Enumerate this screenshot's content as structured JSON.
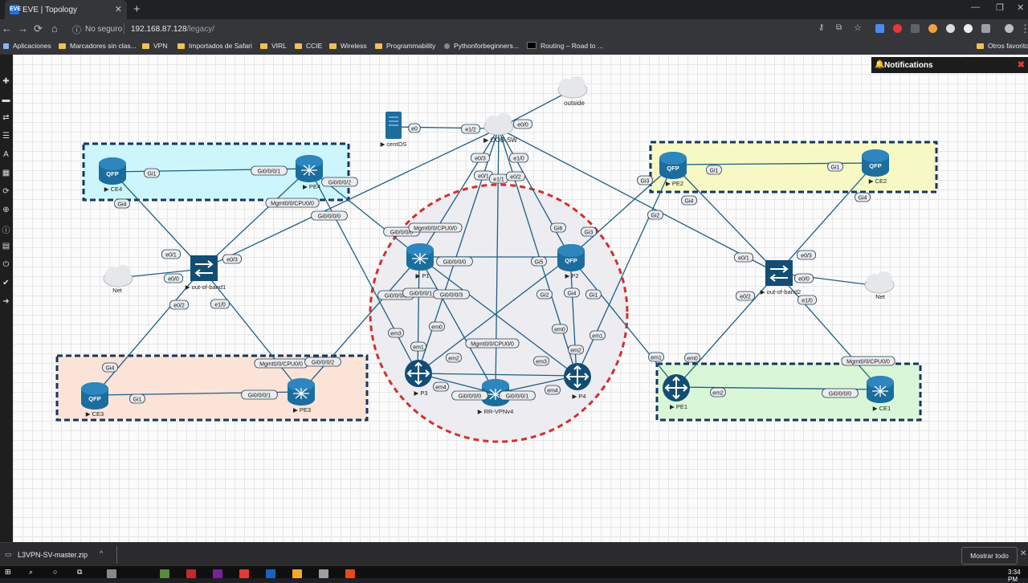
{
  "browser": {
    "tab_title": "EVE | Topology",
    "tab_favicon": "EVE",
    "new_tab": "+",
    "security_label": "No seguro",
    "url_host": "192.168.87.128",
    "url_path": "/legacy/",
    "bookmarks": [
      {
        "label": "Aplicaciones",
        "icon": "apps-icon"
      },
      {
        "label": "Marcadores sin clas...",
        "icon": "folder-icon"
      },
      {
        "label": "VPN",
        "icon": "folder-icon"
      },
      {
        "label": "Importados de Safari",
        "icon": "folder-icon"
      },
      {
        "label": "VIRL",
        "icon": "folder-icon"
      },
      {
        "label": "CCIE",
        "icon": "folder-icon"
      },
      {
        "label": "Wireless",
        "icon": "folder-icon"
      },
      {
        "label": "Programmability",
        "icon": "folder-icon"
      },
      {
        "label": "Pythonforbeginners...",
        "icon": "python-icon"
      },
      {
        "label": "Routing – Road to ...",
        "icon": "page-icon"
      },
      {
        "label": "Otros favoritos",
        "icon": "folder-icon"
      }
    ]
  },
  "notifications": {
    "title": "Notifications",
    "close": "✖"
  },
  "topology": {
    "nodes": {
      "centos": "centOS",
      "oob_sw": "OOB-SW",
      "outside": "outside",
      "ce4": "CE4",
      "pe4": "PE4",
      "ce3": "CE3",
      "pe3": "PE3",
      "oob1": "out-of-band1",
      "oob2": "out-of-band2",
      "net1": "Net",
      "net2": "Net",
      "p1": "P1",
      "p2": "P2",
      "p3": "P3",
      "p4": "P4",
      "rr": "RR-VPNv4",
      "pe2": "PE2",
      "ce2": "CE2",
      "pe1": "PE1",
      "ce1": "CE1"
    },
    "router_badge": "QFP",
    "ports": {
      "centos_e0": "e0",
      "oob_e1_2": "e1/2",
      "oob_e0_0": "e0/0",
      "oob_e0_3": "e0/3",
      "oob_e1_0": "e1/0",
      "oob_e0_1": "e0/1",
      "oob_e1_1": "e1/1",
      "oob_e0_2": "e0/2",
      "ce4_gi1": "Gi1",
      "pe4_gi0001": "Gi0/0/0/1",
      "ce4_gi4": "Gi4",
      "pe4_gi0002": "Gi0/0/0/2",
      "pe4_mgmt": "Mgmt0/0/CPU0/0",
      "pe4_gi0000": "Gi0/0/0/0",
      "o1_e01": "e0/1",
      "o1_e03": "e0/3",
      "o1_e00": "e0/0",
      "o1_e02": "e0/2",
      "o1_e10": "e1/0",
      "ce3_gi4": "Gi4",
      "ce3_gi1": "Gi1",
      "pe3_gi0001": "Gi0/0/0/1",
      "pe3_mgmt": "Mgmt0/0/CPU0/0",
      "pe3_gi0002": "Gi0/0/0/2",
      "p1_gi0000": "Gi0/0/0/0",
      "p1_mgmt": "Mgmt0/0/CPU0/0",
      "p1_gi0000b": "Gi0/0/0/0",
      "p1_gi0002": "Gi0/0/0/2",
      "p1_gi0001": "Gi0/0/0/1",
      "p1_gi0003": "Gi0/0/0/3",
      "p2_gi6": "Gi6",
      "p2_gi3": "Gi3",
      "p2_gi5": "Gi5",
      "p2_gi2": "Gi2",
      "p2_gi4": "Gi4",
      "p2_gi1": "Gi1",
      "p3_em3": "em3",
      "p3_em0": "em0",
      "p3_em1": "em1",
      "p3_em2": "em2",
      "p3_em4": "em4",
      "rr_mgmt": "Mgmt0/0/CPU0/0",
      "rr_gi0000": "Gi0/0/0/0",
      "rr_gi0001": "Gi0/0/0/1",
      "p4_em0": "em0",
      "p4_em2": "em2",
      "p4_em1": "em1",
      "p4_em3": "em3",
      "p4_em4": "em4",
      "pe2_gi3": "Gi3",
      "pe2_gi1": "Gi1",
      "pe2_gi2": "Gi2",
      "pe2_gi4": "Gi4",
      "ce2_gi1": "Gi1",
      "ce2_gi4": "Gi4",
      "o2_e03": "e0/3",
      "o2_e01": "e0/1",
      "o2_e00": "e0/0",
      "o2_e02": "e0/2",
      "o2_e10": "e1/0",
      "pe1_em1": "em1",
      "pe1_em0": "em0",
      "pe1_em2": "em2",
      "ce1_gi0000": "Gi0/0/0/0",
      "ce1_mgmt": "Mgmt0/0/CPU0/0"
    }
  },
  "downloads": {
    "file": "L3VPN-SV-master.zip",
    "chevron": "^",
    "show_all": "Mostrar todo",
    "close": "✕"
  },
  "taskbar": {
    "clock": "3:34 PM"
  },
  "colors": {
    "link": "#1f5f85",
    "router": "#1b6d9e",
    "accent": "#d32f2f"
  }
}
